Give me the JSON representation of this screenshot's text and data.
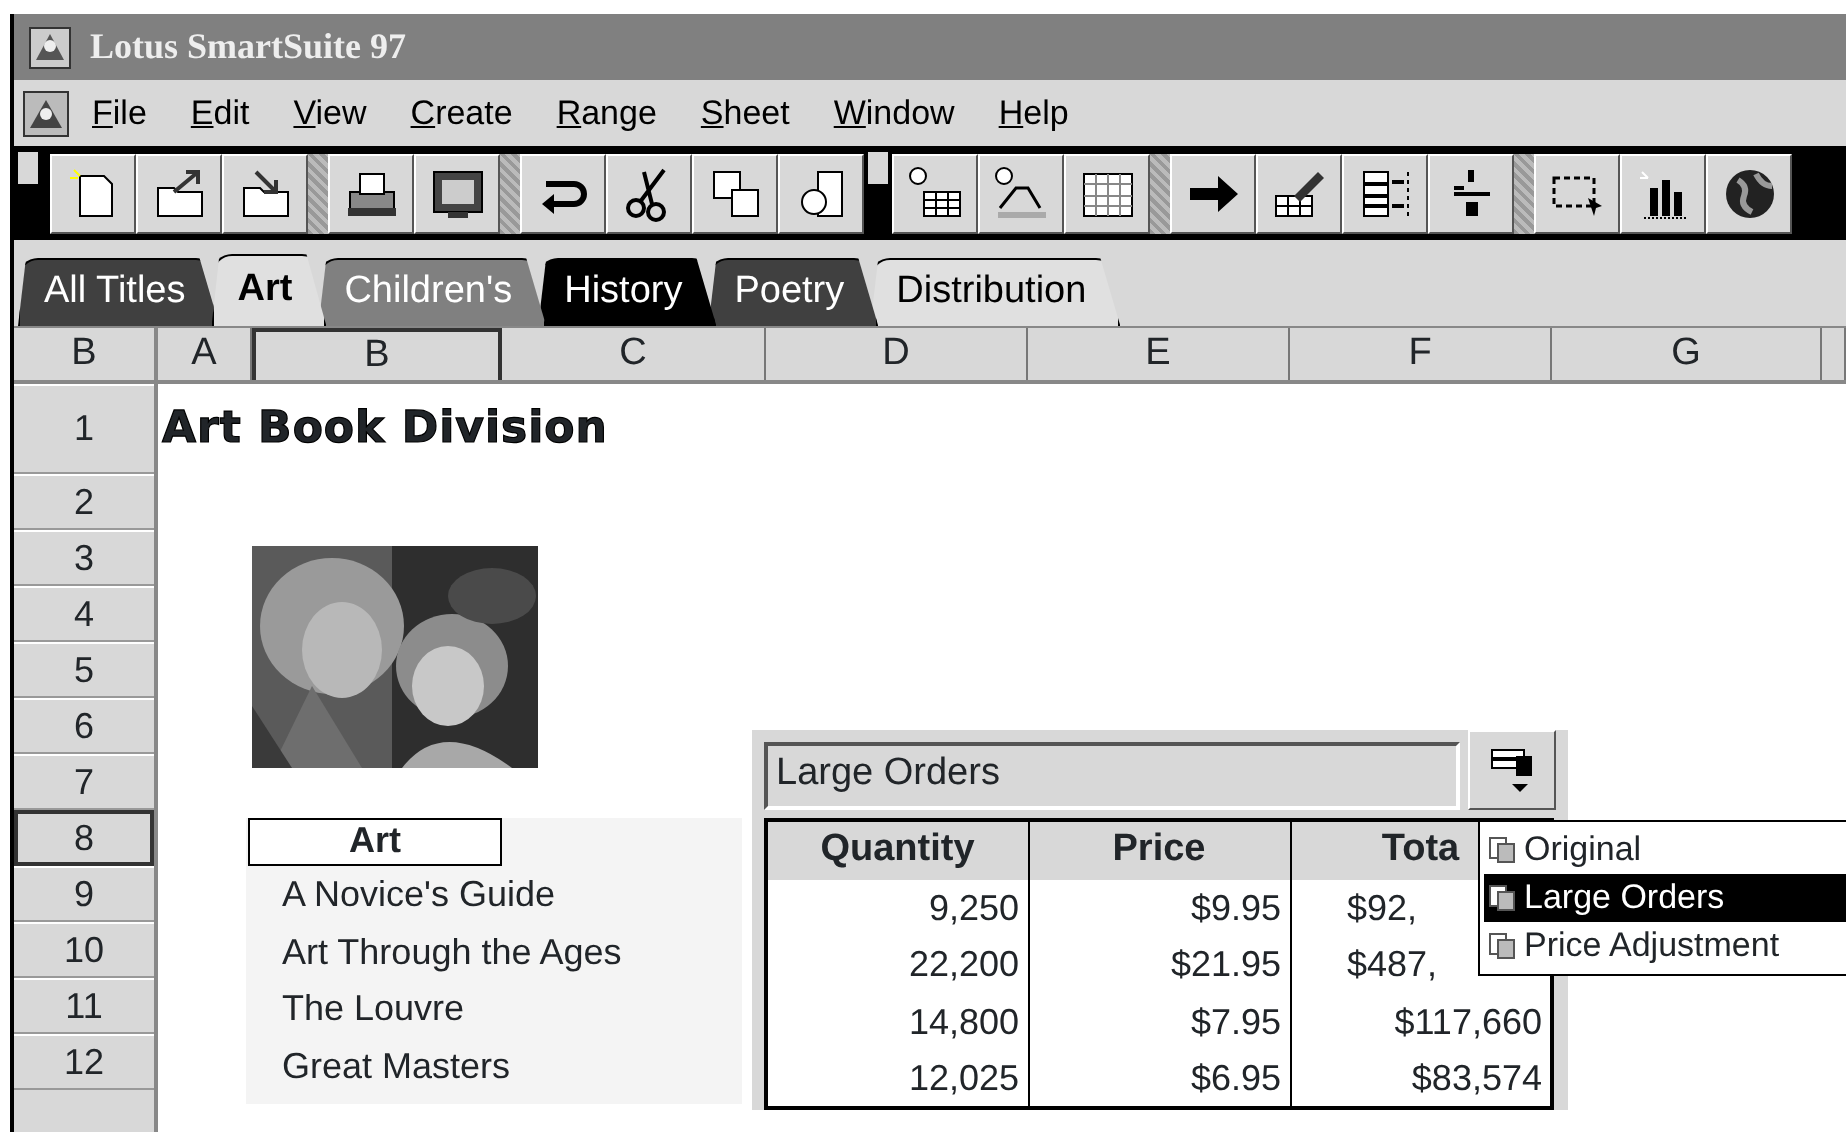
{
  "window": {
    "title": "Lotus SmartSuite 97"
  },
  "menu": [
    {
      "label": "File",
      "mnemonic": true
    },
    {
      "label": "Edit",
      "mnemonic": true
    },
    {
      "label": "View",
      "mnemonic": true
    },
    {
      "label": "Create",
      "mnemonic": true
    },
    {
      "label": "Range",
      "mnemonic": true
    },
    {
      "label": "Sheet",
      "mnemonic": true
    },
    {
      "label": "Window",
      "mnemonic": true
    },
    {
      "label": "Help",
      "mnemonic": true
    }
  ],
  "tabs": [
    {
      "label": "All Titles",
      "selected": false,
      "color": "#404040"
    },
    {
      "label": "Art",
      "selected": true,
      "color": "#e0e0e0"
    },
    {
      "label": "Children's",
      "selected": false,
      "color": "#808080"
    },
    {
      "label": "History",
      "selected": false,
      "color": "#000000"
    },
    {
      "label": "Poetry",
      "selected": false,
      "color": "#404040"
    },
    {
      "label": "Distribution",
      "selected": false,
      "color": "#e0e0e0"
    }
  ],
  "address_box": "B",
  "columns": [
    {
      "label": "A",
      "selected": false
    },
    {
      "label": "B",
      "selected": true
    },
    {
      "label": "C",
      "selected": false
    },
    {
      "label": "D",
      "selected": false
    },
    {
      "label": "E",
      "selected": false
    },
    {
      "label": "F",
      "selected": false
    },
    {
      "label": "G",
      "selected": false
    }
  ],
  "rows": [
    {
      "label": "1",
      "selected": false
    },
    {
      "label": "2",
      "selected": false
    },
    {
      "label": "3",
      "selected": false
    },
    {
      "label": "4",
      "selected": false
    },
    {
      "label": "5",
      "selected": false
    },
    {
      "label": "6",
      "selected": false
    },
    {
      "label": "7",
      "selected": false
    },
    {
      "label": "8",
      "selected": true
    },
    {
      "label": "9",
      "selected": false
    },
    {
      "label": "10",
      "selected": false
    },
    {
      "label": "11",
      "selected": false
    },
    {
      "label": "12",
      "selected": false
    }
  ],
  "sheet": {
    "title": "Art Book Division",
    "list": {
      "header": "Art",
      "items": [
        "A Novice's Guide",
        "Art Through the Ages",
        "The Louvre",
        "Great Masters"
      ]
    }
  },
  "version_range": {
    "current": "Large Orders",
    "columns": [
      "Quantity",
      "Price",
      "Tota"
    ],
    "rows": [
      {
        "quantity": "9,250",
        "price": "$9.95",
        "total": "$92,",
        "total_covered": true
      },
      {
        "quantity": "22,200",
        "price": "$21.95",
        "total": "$487,",
        "total_covered": true
      },
      {
        "quantity": "14,800",
        "price": "$7.95",
        "total": "$117,660",
        "total_covered": false
      },
      {
        "quantity": "12,025",
        "price": "$6.95",
        "total": "$83,574",
        "total_covered": false
      }
    ],
    "menu": [
      {
        "label": "Original",
        "selected": false
      },
      {
        "label": "Large Orders",
        "selected": true
      },
      {
        "label": "Price Adjustment",
        "selected": false
      }
    ]
  }
}
